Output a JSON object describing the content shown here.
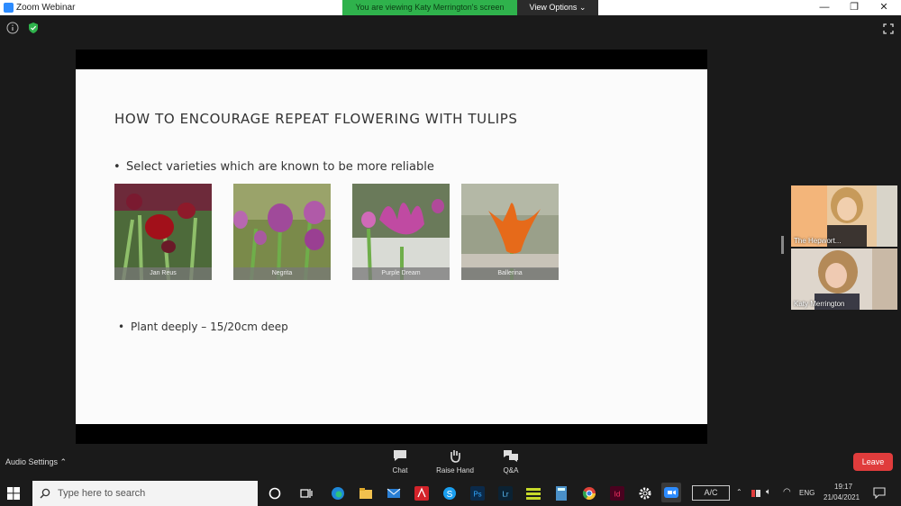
{
  "window": {
    "title": "Zoom Webinar",
    "viewing_banner": "You are viewing Katy Merrington's screen",
    "view_options": "View Options",
    "minimize": "—",
    "maximize": "❐",
    "close": "✕"
  },
  "slide": {
    "title": "HOW TO ENCOURAGE REPEAT FLOWERING WITH TULIPS",
    "bullet_1": "Select varieties which are known to be more reliable",
    "bullet_2": "Plant deeply – 15/20cm deep",
    "bullet_symbol": "•",
    "photos": [
      {
        "caption": "Jan Reus",
        "icon": "tulip-photo-red"
      },
      {
        "caption": "Negrita",
        "icon": "tulip-photo-purple"
      },
      {
        "caption": "Purple Dream",
        "icon": "tulip-photo-pink"
      },
      {
        "caption": "Ballerina",
        "icon": "tulip-photo-orange"
      }
    ]
  },
  "participants": [
    {
      "name": "The Hepwort..."
    },
    {
      "name": "Katy Merrington"
    }
  ],
  "controls": {
    "audio_settings": "Audio Settings",
    "chat": "Chat",
    "raise_hand": "Raise Hand",
    "qa": "Q&A",
    "leave": "Leave"
  },
  "taskbar": {
    "search_placeholder": "Type here to search",
    "ac_label": "A/C",
    "language": "ENG",
    "time": "19:17",
    "date": "21/04/2021"
  },
  "colors": {
    "banner_green": "#2fb24c",
    "leave_red": "#e03c3c",
    "zoom_blue": "#2d8cff"
  }
}
